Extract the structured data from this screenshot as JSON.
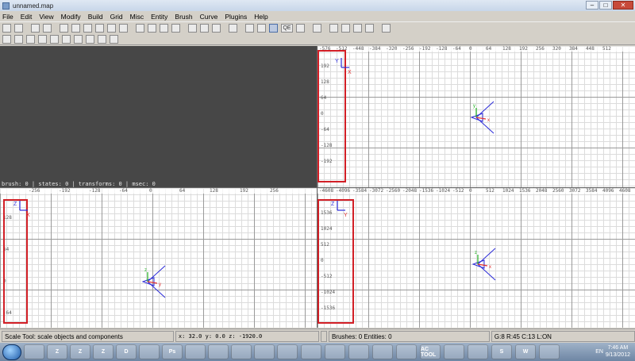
{
  "window": {
    "title": "unnamed.map",
    "controls": {
      "min": "–",
      "max": "□",
      "close": "✕"
    }
  },
  "menu": [
    "File",
    "Edit",
    "View",
    "Modify",
    "Build",
    "Grid",
    "Misc",
    "Entity",
    "Brush",
    "Curve",
    "Plugins",
    "Help"
  ],
  "toolbar1": {
    "icons": [
      "open-icon",
      "save-icon",
      "sep",
      "undo-icon",
      "redo-icon",
      "sep",
      "flip-x-icon",
      "flip-y-icon",
      "flip-z-icon",
      "rotate-x-icon",
      "rotate-y-icon",
      "rotate-z-icon",
      "sep",
      "select-complete-tall-icon",
      "select-touching-icon",
      "select-partial-tall-icon",
      "select-inside-icon",
      "sep",
      "csg-subtract-icon",
      "csg-hollow-icon",
      "csg-merge-icon",
      "sep",
      "view-change-icon",
      "sep",
      "texture-lock-icon",
      "vertex-icon",
      "scale-icon",
      "qe-icon",
      "clipper-icon",
      "sep",
      "brush-icon",
      "sep",
      "cubic-clip-icon",
      "camera-icon",
      "texture-window-icon",
      "view-entity-icon",
      "sep",
      "patch-icon"
    ],
    "qe_label": "QE"
  },
  "toolbar2": {
    "icons": [
      "entity-connect-icon",
      "brush-cylinder-icon",
      "patch-matrix-icon",
      "patch-cap-icon",
      "flip-patch-icon",
      "redisperse-rows-icon",
      "redisperse-cols-icon",
      "insert-row-icon",
      "delete-row-icon",
      "thicken-patch-icon"
    ]
  },
  "camera": {
    "status": "brush: 0 | states: 0 | transforms: 0 | msec: 0"
  },
  "xy_view": {
    "ruler_top": [
      "-576",
      "-512",
      "-448",
      "-384",
      "-320",
      "-256",
      "-192",
      "-128",
      "-64",
      "0",
      "64",
      "128",
      "192",
      "256",
      "320",
      "384",
      "448",
      "512"
    ],
    "ruler_left": [
      "192",
      "128",
      "64",
      "0",
      "-64",
      "-128",
      "-192"
    ],
    "axis_labels": [
      "Y",
      "X"
    ],
    "origin_axes": [
      "y",
      "x"
    ]
  },
  "xz_view": {
    "ruler_top": [
      "-256",
      "-192",
      "-128",
      "-64",
      "0",
      "64",
      "128",
      "192",
      "256"
    ],
    "ruler_left": [
      "128",
      "64",
      "0",
      "-64"
    ],
    "axis_labels": [
      "Z",
      "X"
    ],
    "origin_axes": [
      "z",
      "y"
    ]
  },
  "yz_view": {
    "ruler_top": [
      "-4608",
      "-4096",
      "-3584",
      "-3072",
      "-2560",
      "-2048",
      "-1536",
      "-1024",
      "-512",
      "0",
      "512",
      "1024",
      "1536",
      "2048",
      "2560",
      "3072",
      "3584",
      "4096",
      "4608"
    ],
    "ruler_left": [
      "1536",
      "1024",
      "512",
      "0",
      "-512",
      "-1024",
      "-1536"
    ],
    "axis_labels": [
      "Z",
      "Y"
    ],
    "origin_axes": [
      "z",
      "x"
    ]
  },
  "status_bar": {
    "tool": "Scale Tool: scale objects and components",
    "coords": "x:    32.0  y:    0.0  z:  -1920.0",
    "blank": "",
    "counts": "Brushes: 0 Entities: 0",
    "grid": "G:8  R:45  C:13  L:ON"
  },
  "taskbar": {
    "apps": [
      "",
      "Z",
      "Z",
      "Z",
      "D",
      "",
      "Ps",
      "",
      "",
      "",
      "",
      "",
      "",
      "",
      "",
      "",
      "",
      "AC TOOL",
      "",
      "",
      "S",
      "W",
      ""
    ],
    "tray_lang": "EN",
    "time": "7:46 AM",
    "date": "9/13/2012"
  },
  "colors": {
    "red_highlight": "#d21f26",
    "axis_blue": "#2b2bd8",
    "axis_red": "#e03030",
    "axis_green": "#20b020"
  }
}
